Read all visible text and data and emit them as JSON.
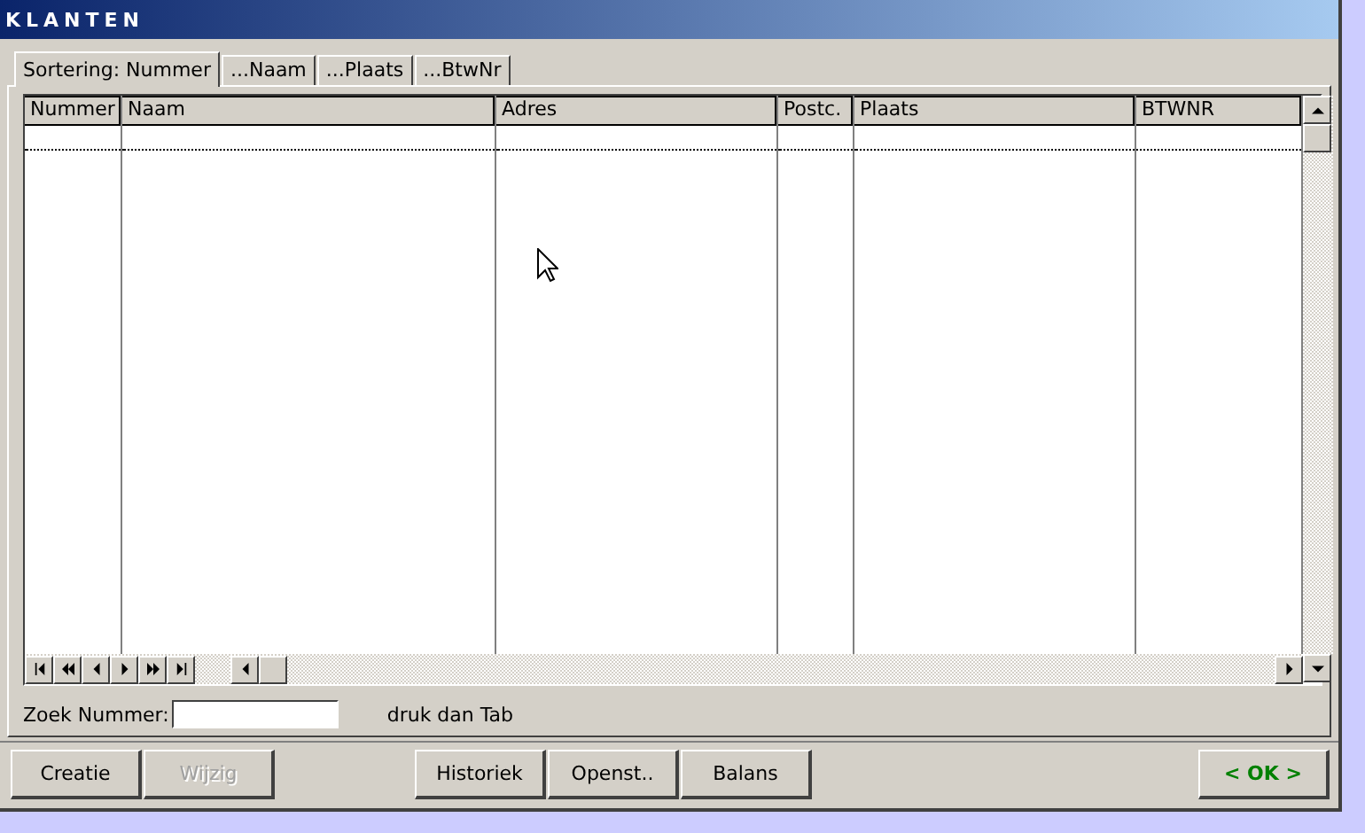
{
  "window": {
    "title": "KLANTEN"
  },
  "tabs": [
    {
      "label": "Sortering: Nummer",
      "selected": true
    },
    {
      "label": "...Naam",
      "selected": false
    },
    {
      "label": "...Plaats",
      "selected": false
    },
    {
      "label": "...BtwNr",
      "selected": false
    }
  ],
  "table": {
    "columns": [
      "Nummer",
      "Naam",
      "Adres",
      "Postc.",
      "Plaats",
      "BTWNR"
    ]
  },
  "search": {
    "label": "Zoek Nummer:",
    "hint": "druk dan Tab"
  },
  "buttons": [
    {
      "label": "Creatie",
      "kind": "normal",
      "disabled": false
    },
    {
      "label": "Wijzig",
      "kind": "normal",
      "disabled": true
    },
    {
      "label": "Historiek",
      "kind": "normal",
      "disabled": false
    },
    {
      "label": "Openst..",
      "kind": "normal",
      "disabled": false
    },
    {
      "label": "Balans",
      "kind": "normal",
      "disabled": false
    },
    {
      "label": "< OK >",
      "kind": "ok",
      "disabled": false
    }
  ]
}
